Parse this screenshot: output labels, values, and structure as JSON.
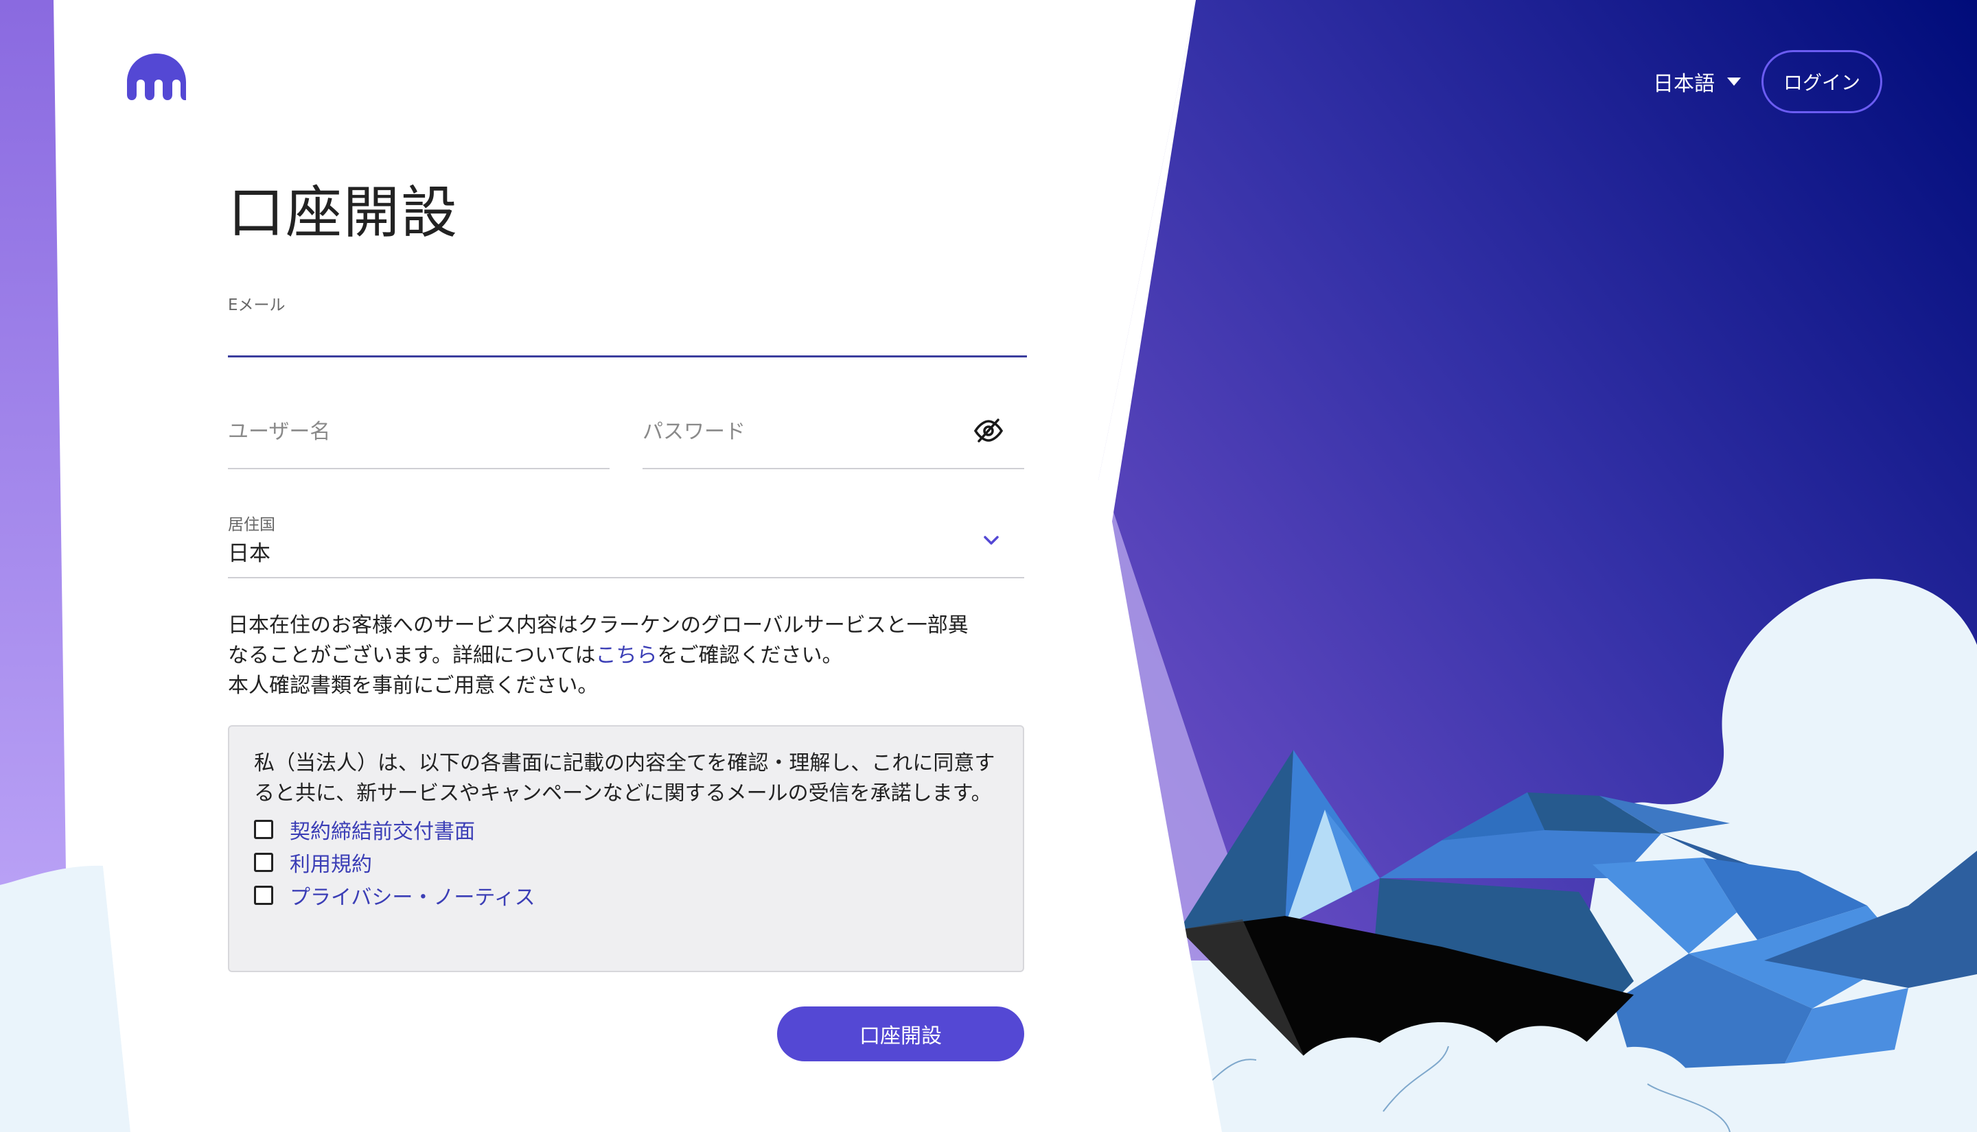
{
  "header": {
    "language_label": "日本語",
    "login_label": "ログイン"
  },
  "form": {
    "title": "口座開設",
    "email_label": "Eメール",
    "email_value": "",
    "username_placeholder": "ユーザー名",
    "password_placeholder": "パスワード",
    "country_label": "居住国",
    "country_value": "日本",
    "notice_line1": "日本在住のお客様へのサービス内容はクラーケンのグローバルサービスと一部異",
    "notice_line2_pre": "なることがございます。詳細については",
    "notice_link": "こちら",
    "notice_line2_post": "をご確認ください。",
    "notice_line3": "本人確認書類を事前にご用意ください。",
    "consent_text": "私（当法人）は、以下の各書面に記載の内容全てを確認・理解し、これに同意すると共に、新サービスやキャンペーンなどに関するメールの受信を承諾します。",
    "checkboxes": [
      {
        "label": "契約締結前交付書面",
        "checked": false
      },
      {
        "label": "利用規約",
        "checked": false
      },
      {
        "label": "プライバシー・ノーティス",
        "checked": false
      }
    ],
    "submit_label": "口座開設"
  },
  "icons": {
    "logo": "kraken-logo-icon",
    "password_toggle": "eye-slash-icon",
    "country_dropdown": "chevron-down-icon",
    "language_dropdown": "caret-down-icon"
  },
  "colors": {
    "brand": "#5448d4",
    "link": "#3b3eb6",
    "bg_dark": "#0a0f82",
    "bg_light": "#6a50c8"
  }
}
